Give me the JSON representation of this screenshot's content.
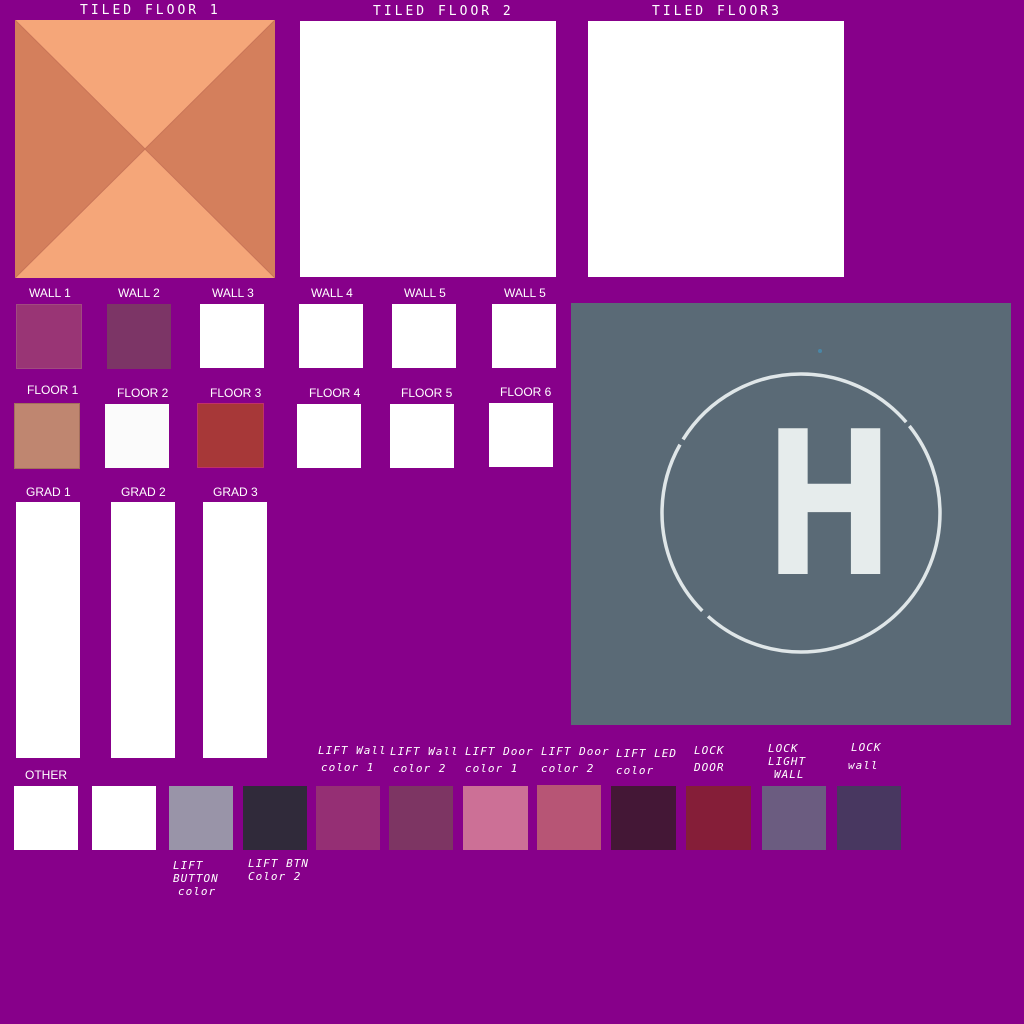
{
  "titles": {
    "tiled1": "TILED FLOOR 1",
    "tiled2": "TILED FLOOR 2",
    "tiled3": "TILED FLOOR3"
  },
  "walls": [
    "WALL 1",
    "WALL 2",
    "WALL 3",
    "WALL 4",
    "WALL 5",
    "WALL 5"
  ],
  "floors": [
    "FLOOR 1",
    "FLOOR 2",
    "FLOOR 3",
    "FLOOR 4",
    "FLOOR 5",
    "FLOOR 6"
  ],
  "grads": [
    "GRAD 1",
    "GRAD 2",
    "GRAD 3"
  ],
  "other": {
    "label": "OTHER",
    "lift_button_color": [
      "LIFT",
      "BUTTON",
      "color"
    ],
    "lift_btn_color2": [
      "LIFT BTN",
      "Color 2"
    ],
    "lift_wall_color1": [
      "LIFT Wall",
      "color 1"
    ],
    "lift_wall_color2": [
      "LIFT Wall",
      "color 2"
    ],
    "lift_door_color1": [
      "LIFT Door",
      "color 1"
    ],
    "lift_door_color2": [
      "LIFT Door",
      "color 2"
    ],
    "lift_led_color": [
      "LIFT LED",
      "color"
    ],
    "lock_door": [
      "LOCK",
      "DOOR"
    ],
    "lock_light_wall": [
      "LOCK",
      "LIGHT",
      "WALL"
    ],
    "lock_wall": [
      "LOCK",
      "wall"
    ]
  },
  "decal": {
    "letter": "H"
  },
  "colors": {
    "background": "#87008a",
    "tile1_light": "#f5a679",
    "tile1_dark": "#d47f5c",
    "wall1": "#993575",
    "wall2": "#7c3566",
    "floor1": "#bf8670",
    "floor3": "#a73838",
    "lift_button": "#9994a8",
    "lift_btn2": "#302a3a",
    "lift_wall1": "#952f74",
    "lift_wall2": "#7d3563",
    "lift_door1": "#cc7096",
    "lift_door2": "#b75575",
    "lift_led": "#441736",
    "lock_door": "#851e38",
    "lock_light_wall": "#6b5c80",
    "lock_wall": "#483760",
    "decal_bg": "#5a6a76",
    "white": "#ffffff"
  }
}
